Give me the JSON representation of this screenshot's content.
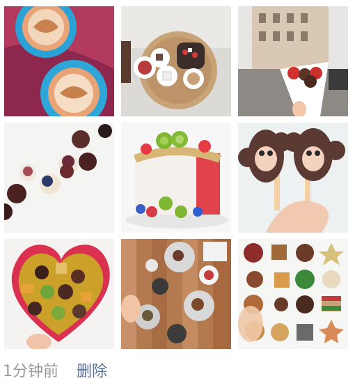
{
  "post": {
    "images": [
      {
        "icon": "latte-art-photo"
      },
      {
        "icon": "fondue-tray-photo"
      },
      {
        "icon": "chocolate-strawberries-street-photo"
      },
      {
        "icon": "mini-cupcakes-photo"
      },
      {
        "icon": "fruit-cake-photo"
      },
      {
        "icon": "monkey-ice-cream-photo"
      },
      {
        "icon": "heart-chocolate-box-photo"
      },
      {
        "icon": "wooden-table-plates-photo"
      },
      {
        "icon": "cookie-assortment-photo"
      }
    ],
    "timestamp": "1分钟前",
    "delete_label": "删除"
  },
  "colors": {
    "timestamp": "#9a9a9a",
    "delete_link": "#5a6f96"
  }
}
